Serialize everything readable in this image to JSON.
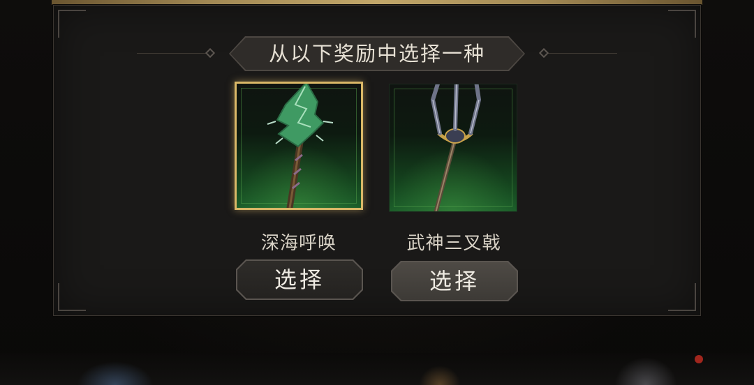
{
  "dialog": {
    "title": "从以下奖励中选择一种"
  },
  "rewards": [
    {
      "name": "深海呼唤",
      "button_label": "选择",
      "icon": "conch-mace-icon",
      "selected": true
    },
    {
      "name": "武神三叉戟",
      "button_label": "选择",
      "icon": "trident-icon",
      "selected": false
    }
  ],
  "colors": {
    "selected_border": "#d9b767",
    "card_glow": "#1c5e2a",
    "panel_bg": "#1a1918"
  }
}
